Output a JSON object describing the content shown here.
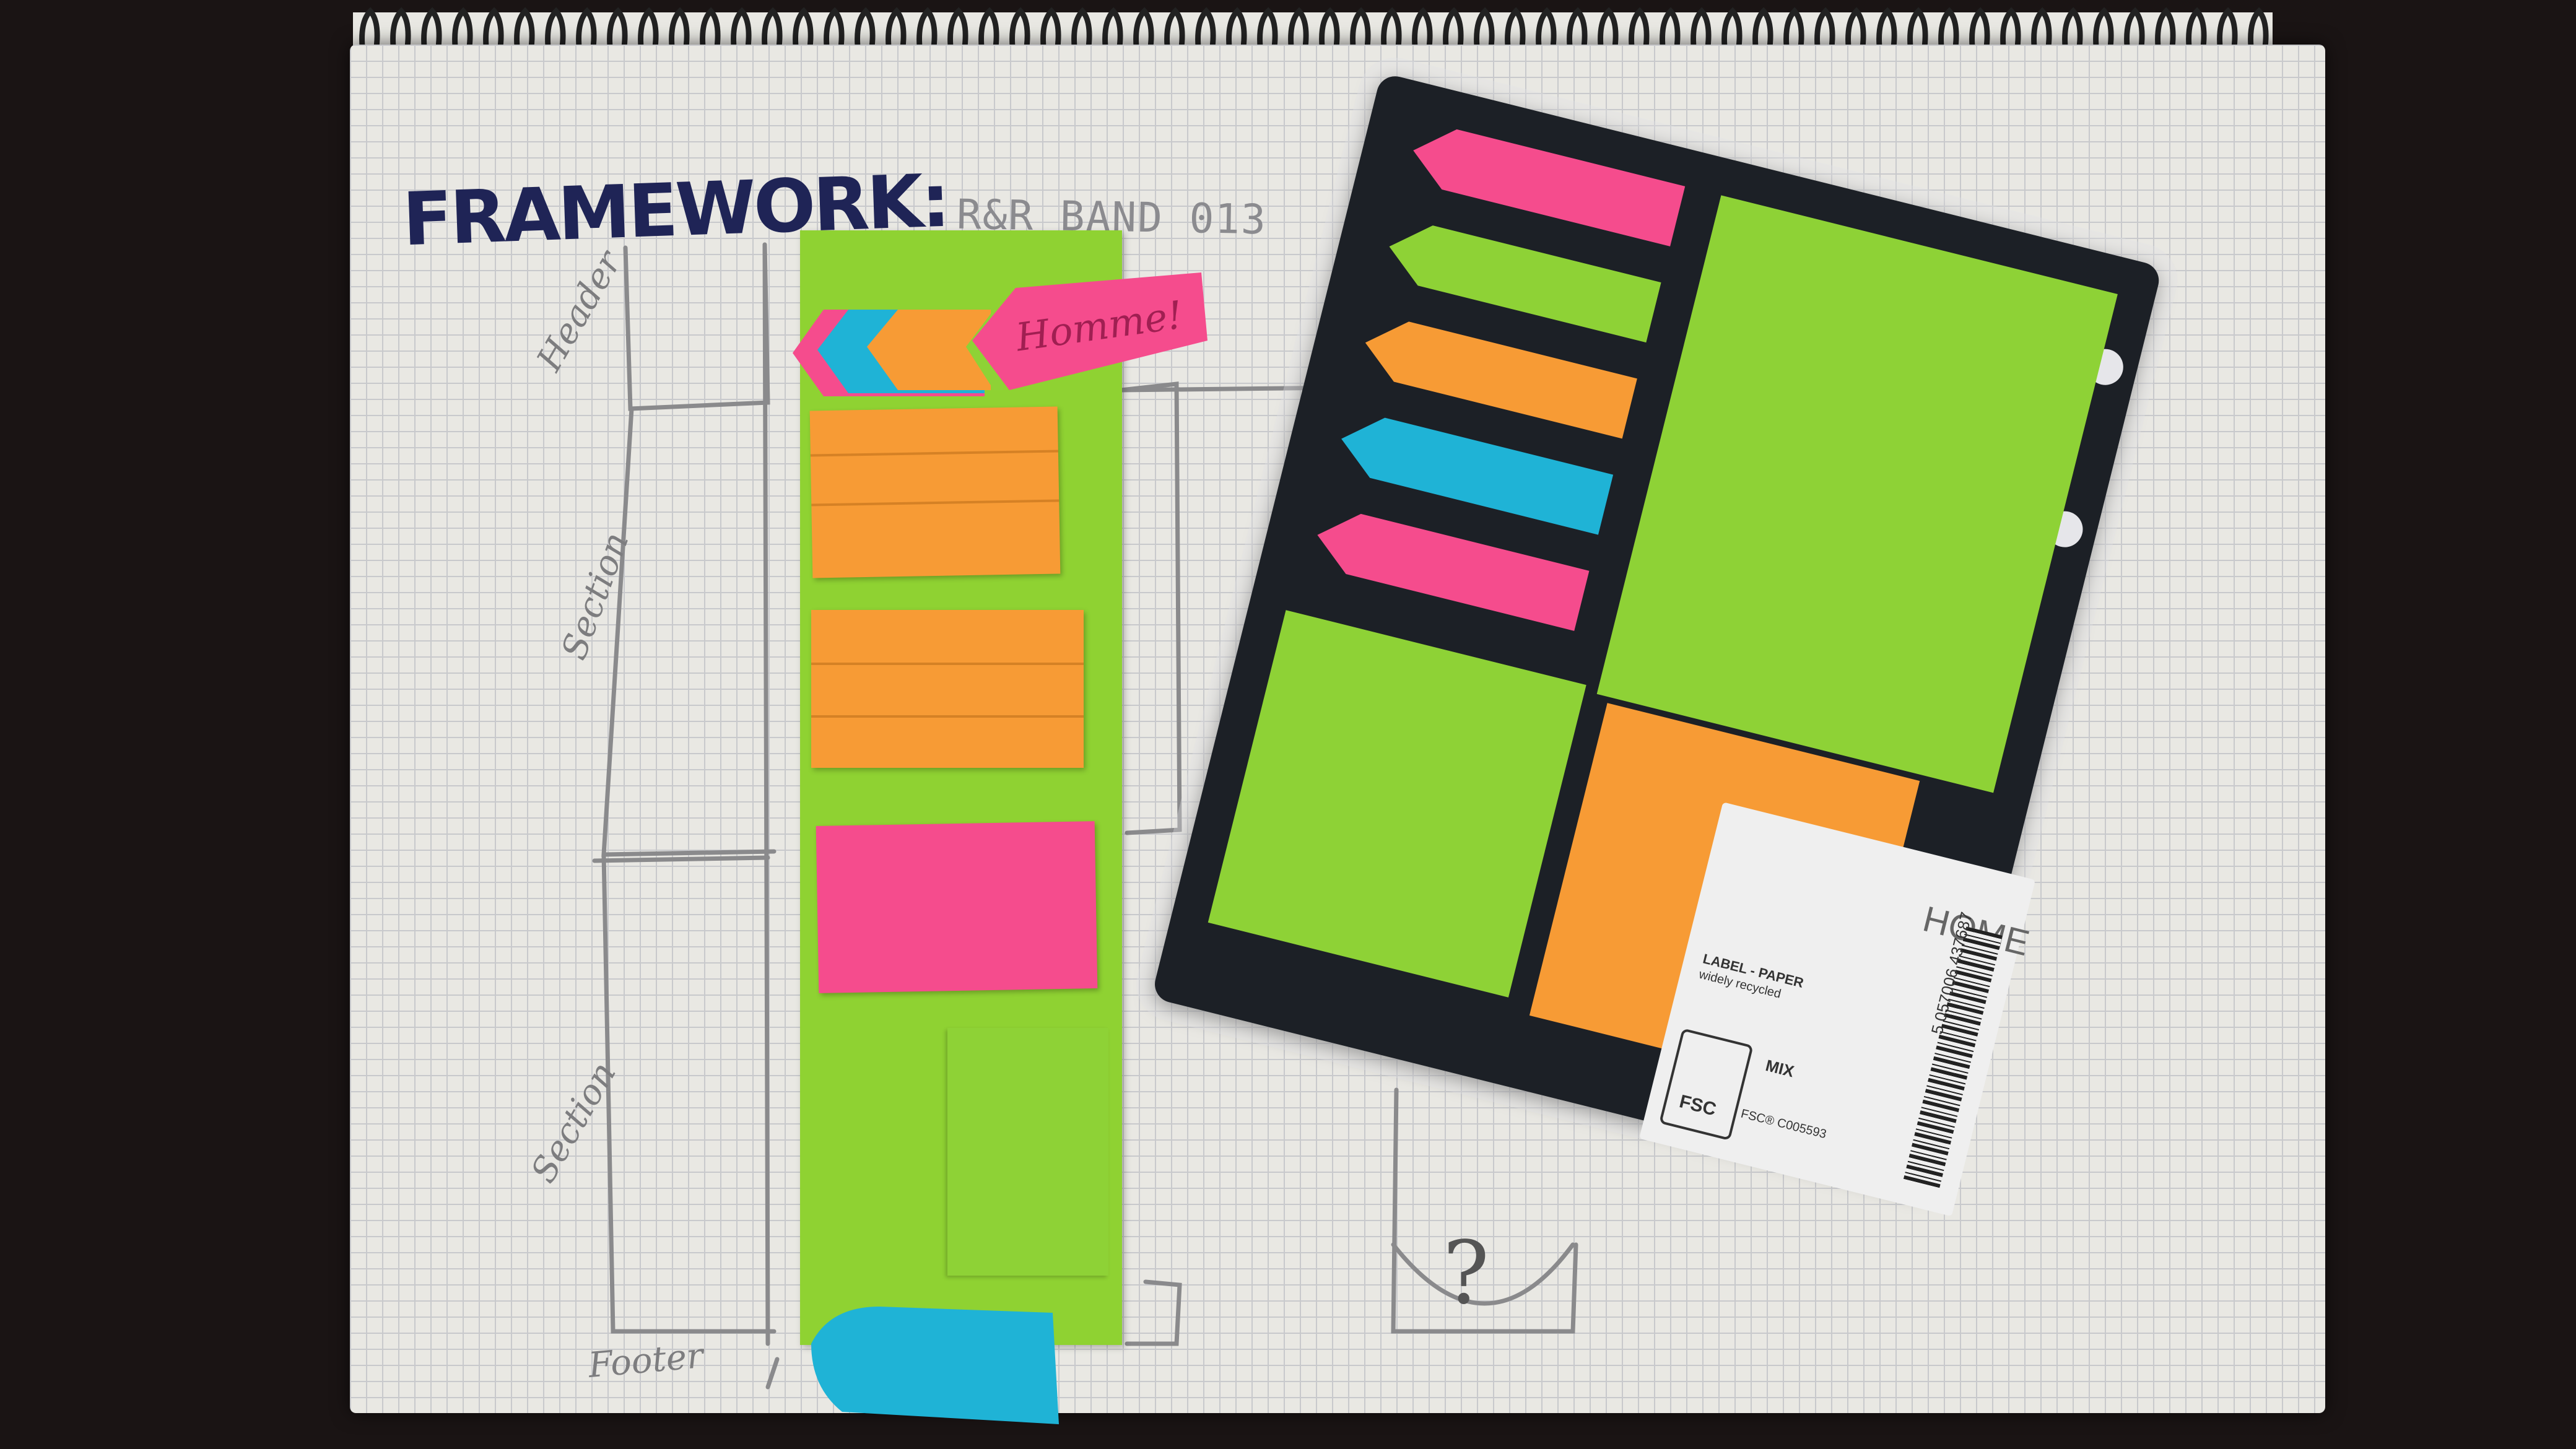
{
  "notebook": {
    "title": "FRAMEWORK:",
    "subtitle": "R&R BAND 013",
    "margin_labels": [
      "Header",
      "Section",
      "Section",
      "Footer"
    ],
    "question_mark": "?"
  },
  "sticky_notes": {
    "arrow_text": "Homme!"
  },
  "package": {
    "brand": "HOME",
    "recycle_label": "LABEL - PAPER",
    "recycle_sub": "widely recycled",
    "fsc_mark": "FSC",
    "fsc_mix": "MIX",
    "fsc_code": "FSC® C005593",
    "barcode_number": "5 057006 437687"
  },
  "colors": {
    "pink": "#f54c8d",
    "green": "#8ed236",
    "orange": "#f79b35",
    "blue": "#1fb3d6",
    "notebook_paper": "#e9e8e3",
    "ink": "#1f2456"
  }
}
